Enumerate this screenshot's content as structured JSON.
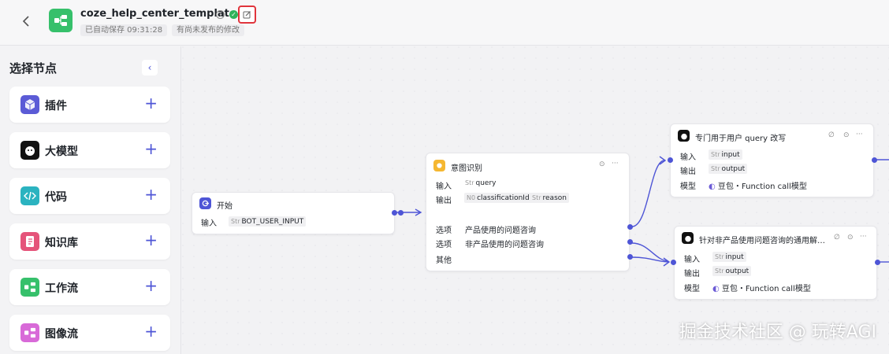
{
  "header": {
    "title": "coze_help_center_template",
    "save_status": "已自动保存 09:31:28",
    "unpublished": "有尚未发布的修改",
    "back_icon": "chevron-left-icon",
    "edit_icon": "edit-icon"
  },
  "panel": {
    "title": "选择节点",
    "items": [
      {
        "label": "插件",
        "icon": "plugin-icon",
        "color": "#5b5bd6"
      },
      {
        "label": "大模型",
        "icon": "llm-icon",
        "color": "#111111"
      },
      {
        "label": "代码",
        "icon": "code-icon",
        "color": "#2bb3c0"
      },
      {
        "label": "知识库",
        "icon": "knowledge-icon",
        "color": "#e5547a"
      },
      {
        "label": "工作流",
        "icon": "workflow-icon",
        "color": "#36c06b"
      },
      {
        "label": "图像流",
        "icon": "imageflow-icon",
        "color": "#d86ad8"
      }
    ]
  },
  "nodes": {
    "start": {
      "title": "开始",
      "input_key": "输入",
      "input_type": "Str",
      "input_value": "BOT_USER_INPUT"
    },
    "intent": {
      "title": "意图识别",
      "input_key": "输入",
      "input_type": "Str",
      "input_value": "query",
      "output_key": "输出",
      "out1_type": "N0",
      "out1_value": "classificationId",
      "out2_type": "Str",
      "out2_value": "reason",
      "option_key": "选项",
      "option1": "产品使用的问题咨询",
      "option2": "非产品使用的问题咨询",
      "other": "其他"
    },
    "rewrite": {
      "title": "专门用于用户 query 改写",
      "input_key": "输入",
      "input_type": "Str",
      "input_value": "input",
      "output_key": "输出",
      "output_type": "Str",
      "output_value": "output",
      "model_key": "模型",
      "model_value": "豆包・Function call模型"
    },
    "general": {
      "title": "针对非产品使用问题咨询的通用解…",
      "input_key": "输入",
      "input_type": "Str",
      "input_value": "input",
      "output_key": "输出",
      "output_type": "Str",
      "output_value": "output",
      "model_key": "模型",
      "model_value": "豆包・Function call模型"
    }
  },
  "watermark": "掘金技术社区 @ 玩转AGI"
}
